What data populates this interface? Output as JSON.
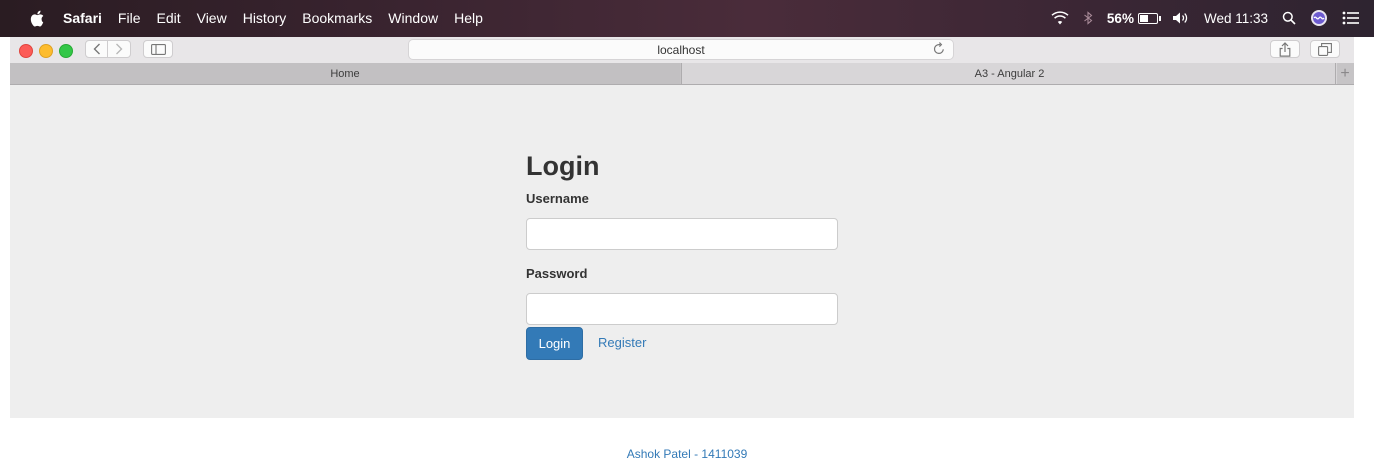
{
  "menubar": {
    "app_name": "Safari",
    "menus": [
      "File",
      "Edit",
      "View",
      "History",
      "Bookmarks",
      "Window",
      "Help"
    ],
    "battery_percent": "56%",
    "battery_level": 0.56,
    "clock": "Wed 11:33"
  },
  "browser": {
    "url": "localhost",
    "tabs": [
      {
        "label": "Home",
        "active": false
      },
      {
        "label": "A3 - Angular 2",
        "active": true
      }
    ],
    "add_tab_label": "+"
  },
  "login": {
    "title": "Login",
    "username_label": "Username",
    "username_value": "",
    "password_label": "Password",
    "password_value": "",
    "login_button": "Login",
    "register_link": "Register"
  },
  "footer": {
    "text": "Ashok Patel - 1411039"
  },
  "colors": {
    "primary": "#337ab7",
    "page_bg": "#eeeeee"
  }
}
